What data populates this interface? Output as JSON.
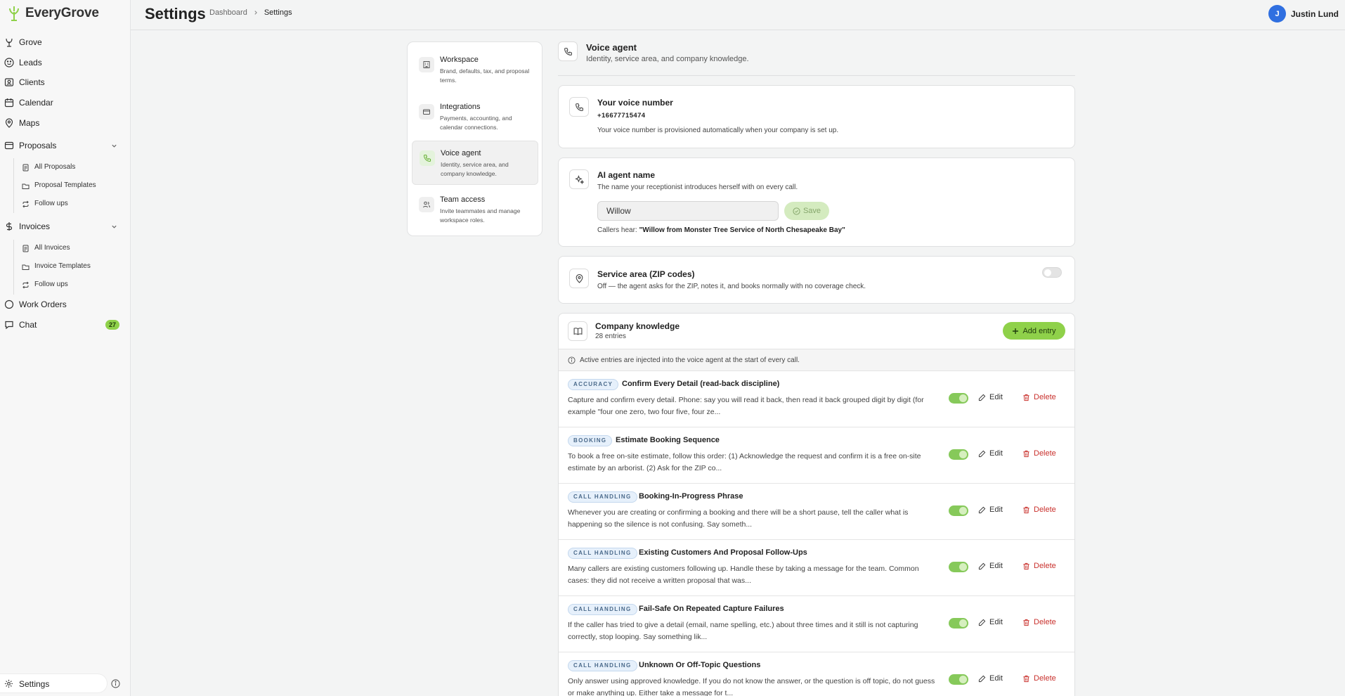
{
  "app": {
    "name": "EveryGrove"
  },
  "sidebar": {
    "items": [
      {
        "label": "Grove",
        "icon": "tree-icon"
      },
      {
        "label": "Leads",
        "icon": "smile-icon"
      },
      {
        "label": "Clients",
        "icon": "contact-card-icon"
      },
      {
        "label": "Calendar",
        "icon": "calendar-icon"
      },
      {
        "label": "Maps",
        "icon": "map-pin-icon"
      },
      {
        "label": "Proposals",
        "icon": "clipboard-icon"
      },
      {
        "label": "Invoices",
        "icon": "dollar-icon"
      },
      {
        "label": "Work Orders",
        "icon": "circle-icon"
      },
      {
        "label": "Chat",
        "icon": "chat-icon",
        "badge": "27"
      }
    ],
    "proposals_sub": [
      {
        "label": "All Proposals"
      },
      {
        "label": "Proposal Templates"
      },
      {
        "label": "Follow ups"
      }
    ],
    "invoices_sub": [
      {
        "label": "All Invoices"
      },
      {
        "label": "Invoice Templates"
      },
      {
        "label": "Follow ups"
      }
    ],
    "settings_label": "Settings"
  },
  "header": {
    "title": "Settings",
    "breadcrumb": [
      "Dashboard",
      "Settings"
    ],
    "user_initial": "J",
    "user_name": "Justin Lund"
  },
  "settings_nav": [
    {
      "title": "Workspace",
      "desc": "Brand, defaults, tax, and proposal terms.",
      "icon": "building-icon"
    },
    {
      "title": "Integrations",
      "desc": "Payments, accounting, and calendar connections.",
      "icon": "card-icon"
    },
    {
      "title": "Voice agent",
      "desc": "Identity, service area, and company knowledge.",
      "icon": "phone-icon",
      "active": true
    },
    {
      "title": "Team access",
      "desc": "Invite teammates and manage workspace roles.",
      "icon": "users-icon"
    }
  ],
  "voice": {
    "title": "Voice agent",
    "subtitle": "Identity, service area, and company knowledge.",
    "number_card": {
      "title": "Your voice number",
      "number": "+16677715474",
      "note": "Your voice number is provisioned automatically when your company is set up."
    },
    "name_card": {
      "title": "AI agent name",
      "subtitle": "The name your receptionist introduces herself with on every call.",
      "value": "Willow",
      "save_label": "Save",
      "callers_prefix": "Callers hear:",
      "callers_value": "\"Willow from Monster Tree Service of North Chesapeake Bay\""
    },
    "service_card": {
      "title": "Service area (ZIP codes)",
      "subtitle": "Off — the agent asks for the ZIP, notes it, and books normally with no coverage check.",
      "enabled": false
    },
    "knowledge": {
      "title": "Company knowledge",
      "count": "28 entries",
      "add_label": "Add entry",
      "info": "Active entries are injected into the voice agent at the start of every call.",
      "edit_label": "Edit",
      "delete_label": "Delete",
      "entries": [
        {
          "tag": "ACCURACY",
          "title": "Confirm Every Detail (read-back discipline)",
          "body": "Capture and confirm every detail. Phone: say you will read it back, then read it back grouped digit by digit (for example \"four one zero, two four five, four ze...",
          "active": true
        },
        {
          "tag": "BOOKING",
          "title": "Estimate Booking Sequence",
          "body": "To book a free on-site estimate, follow this order: (1) Acknowledge the request and confirm it is a free on-site estimate by an arborist. (2) Ask for the ZIP co...",
          "active": true
        },
        {
          "tag": "CALL HANDLING",
          "title": "Booking-In-Progress Phrase",
          "body": "Whenever you are creating or confirming a booking and there will be a short pause, tell the caller what is happening so the silence is not confusing. Say someth...",
          "active": true
        },
        {
          "tag": "CALL HANDLING",
          "title": "Existing Customers And Proposal Follow-Ups",
          "body": "Many callers are existing customers following up. Handle these by taking a message for the team. Common cases: they did not receive a written proposal that was...",
          "active": true
        },
        {
          "tag": "CALL HANDLING",
          "title": "Fail-Safe On Repeated Capture Failures",
          "body": "If the caller has tried to give a detail (email, name spelling, etc.) about three times and it still is not capturing correctly, stop looping. Say something lik...",
          "active": true
        },
        {
          "tag": "CALL HANDLING",
          "title": "Unknown Or Off-Topic Questions",
          "body": "Only answer using approved knowledge. If you do not know the answer, or the question is off topic, do not guess or make anything up. Either take a message for t...",
          "active": true
        }
      ]
    }
  },
  "colors": {
    "accent": "#8fd14a",
    "danger": "#c9302c",
    "avatar": "#2f6fe0"
  }
}
